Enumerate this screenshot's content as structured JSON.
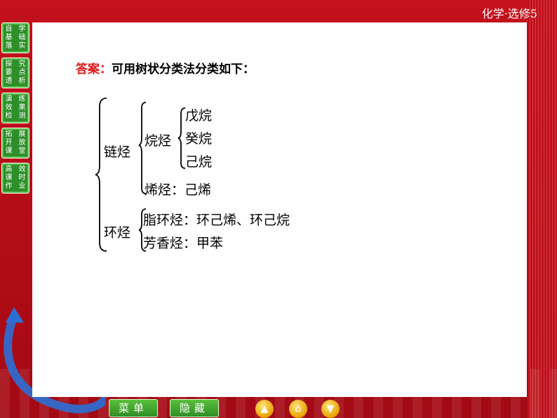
{
  "header": {
    "title": "化学·选修5"
  },
  "sidebar": {
    "items": [
      {
        "chars": [
          "自",
          "学",
          "基",
          "础",
          "落",
          "实"
        ]
      },
      {
        "chars": [
          "探",
          "究",
          "要",
          "点",
          "透",
          "析"
        ]
      },
      {
        "chars": [
          "演",
          "练",
          "效",
          "果",
          "检",
          "测"
        ]
      },
      {
        "chars": [
          "拓",
          "展",
          "开",
          "放",
          "课",
          "堂"
        ]
      },
      {
        "chars": [
          "高",
          "效",
          "课",
          "时",
          "作",
          "业"
        ]
      }
    ]
  },
  "answer": {
    "label": "答案：",
    "text": "可用树状分类法分类如下："
  },
  "tree": {
    "chain": "链烃",
    "alkane": "烷烃",
    "alkane_items": [
      "戊烷",
      "癸烷",
      "己烷"
    ],
    "alkene": "烯烃：己烯",
    "cyclic": "环烃",
    "cyclic_items": [
      "脂环烃：环己烯、环己烷",
      "芳香烃：甲苯"
    ]
  },
  "bottom": {
    "menu": "菜单",
    "hide": "隐藏"
  },
  "colors": {
    "accent_red": "#e01a1a",
    "frame_red": "#c4111c",
    "nav_green": "#2e8f2a"
  }
}
